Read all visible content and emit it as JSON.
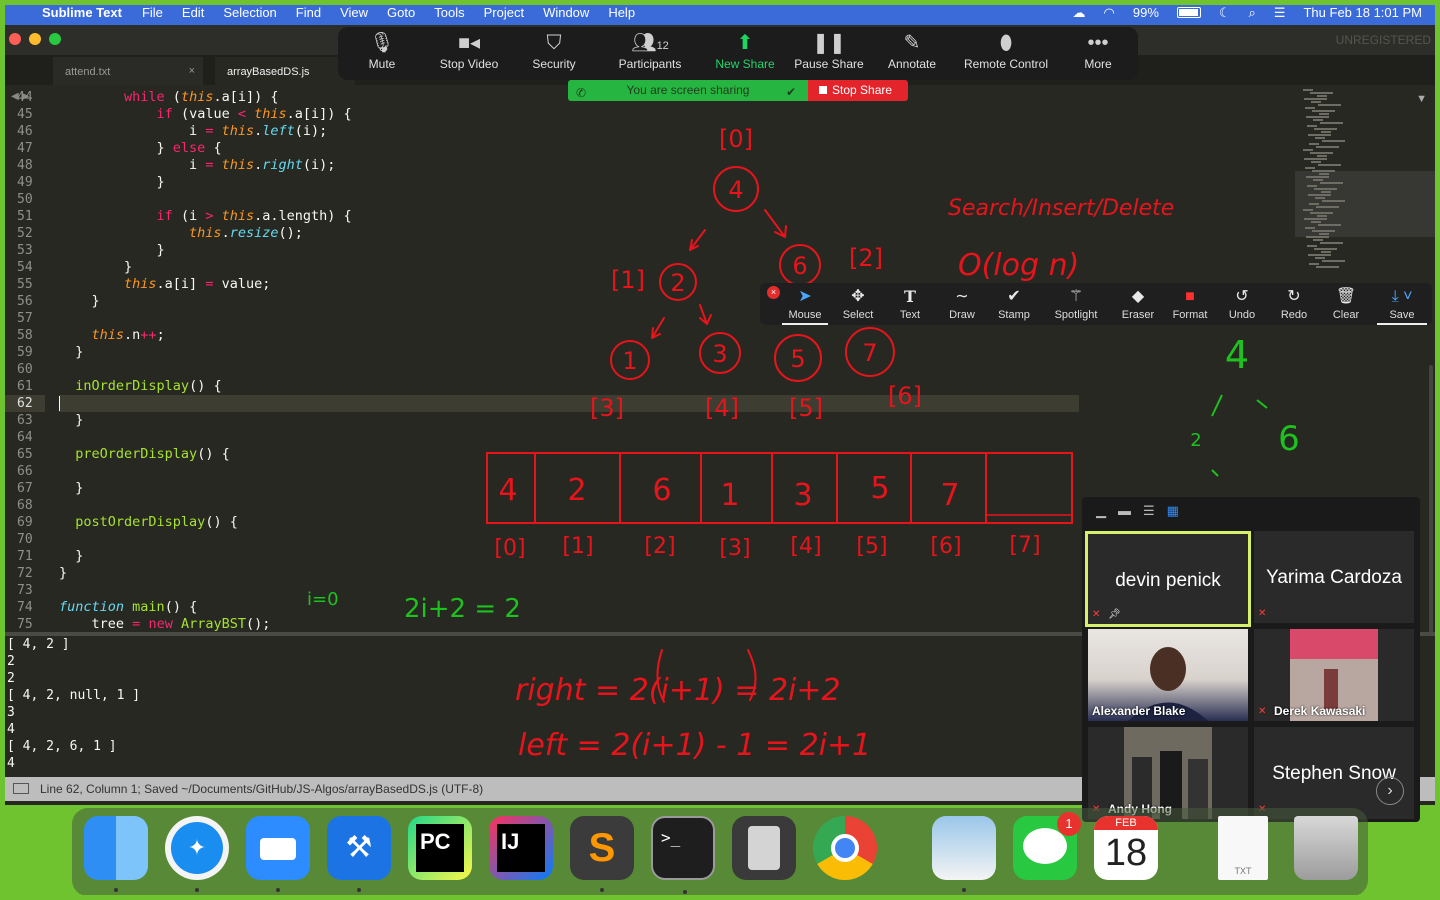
{
  "menubar": {
    "app": "Sublime Text",
    "items": [
      "File",
      "Edit",
      "Selection",
      "Find",
      "View",
      "Goto",
      "Tools",
      "Project",
      "Window",
      "Help"
    ],
    "battery": "99%",
    "clock": "Thu Feb 18  1:01 PM"
  },
  "window": {
    "unregistered": "UNREGISTERED"
  },
  "tabs": [
    {
      "label": "attend.txt",
      "close": "×"
    },
    {
      "label": "arrayBasedDS.js"
    }
  ],
  "zoom_toolbar": {
    "mute": "Mute",
    "stop_video": "Stop Video",
    "security": "Security",
    "participants": "Participants",
    "participant_count": "12",
    "new_share": "New Share",
    "pause_share": "Pause Share",
    "annotate": "Annotate",
    "remote_control": "Remote Control",
    "more": "More"
  },
  "share_banner": {
    "text": "You are screen sharing",
    "stop": "Stop Share"
  },
  "annotation_toolbar": {
    "tools": [
      "Mouse",
      "Select",
      "Text",
      "Draw",
      "Stamp",
      "Spotlight",
      "Eraser",
      "Format",
      "Undo",
      "Redo",
      "Clear",
      "Save"
    ],
    "active": "Mouse"
  },
  "editor": {
    "line_numbers": [
      "44",
      "45",
      "46",
      "47",
      "48",
      "49",
      "50",
      "51",
      "52",
      "53",
      "54",
      "55",
      "56",
      "57",
      "58",
      "59",
      "60",
      "61",
      "62",
      "63",
      "64",
      "65",
      "66",
      "67",
      "68",
      "69",
      "70",
      "71",
      "72",
      "73",
      "74",
      "75"
    ],
    "current_line": "62",
    "output_lines": [
      "[ 4, 2 ]",
      "2",
      "2",
      "[ 4, 2, null, 1 ]",
      "3",
      "4",
      "[ 4, 2, 6, 1 ]",
      "4"
    ],
    "status": "Line 62, Column 1; Saved ~/Documents/GitHub/JS-Algos/arrayBasedDS.js (UTF-8)"
  },
  "annotations": {
    "tree_nodes": [
      "4",
      "2",
      "6",
      "1",
      "3",
      "5",
      "7"
    ],
    "tree_indices": [
      "[0]",
      "[1]",
      "[2]",
      "[3]",
      "[4]",
      "[5]",
      "[6]"
    ],
    "array_values": [
      "4",
      "2",
      "6",
      "1",
      "3",
      "5",
      "7",
      ""
    ],
    "array_indices": [
      "[0]",
      "[1]",
      "[2]",
      "[3]",
      "[4]",
      "[5]",
      "[6]",
      "[7]"
    ],
    "ops": "Search/Insert/Delete",
    "complexity": "O(log n)",
    "i_eq": "i=0",
    "two_i": "2i+2 = 2",
    "right_formula": "right = 2(i+1) = 2i+2",
    "left_formula": "left = 2(i+1) - 1 = 2i+1",
    "mini_tree": [
      "4",
      "2",
      "6"
    ]
  },
  "gallery": {
    "participants": [
      {
        "name": "devin penick",
        "type": "name"
      },
      {
        "name": "Yarima Cardoza",
        "type": "name"
      },
      {
        "name": "Alexander Blake",
        "type": "video"
      },
      {
        "name": "Derek Kawasaki",
        "type": "video"
      },
      {
        "name": "Andy Hong",
        "type": "video"
      },
      {
        "name": "Stephen Snow",
        "type": "name"
      }
    ]
  },
  "dock": {
    "apps": [
      "Finder",
      "Safari",
      "Zoom",
      "Xcode",
      "PyCharm",
      "IntelliJ IDEA",
      "Sublime Text",
      "Terminal",
      "Calculator",
      "Chrome",
      "Preview",
      "Messages",
      "Calendar",
      "TXT",
      "Trash"
    ],
    "messages_badge": "1",
    "calendar_month": "FEB",
    "calendar_day": "18",
    "txt_label": "TXT"
  }
}
